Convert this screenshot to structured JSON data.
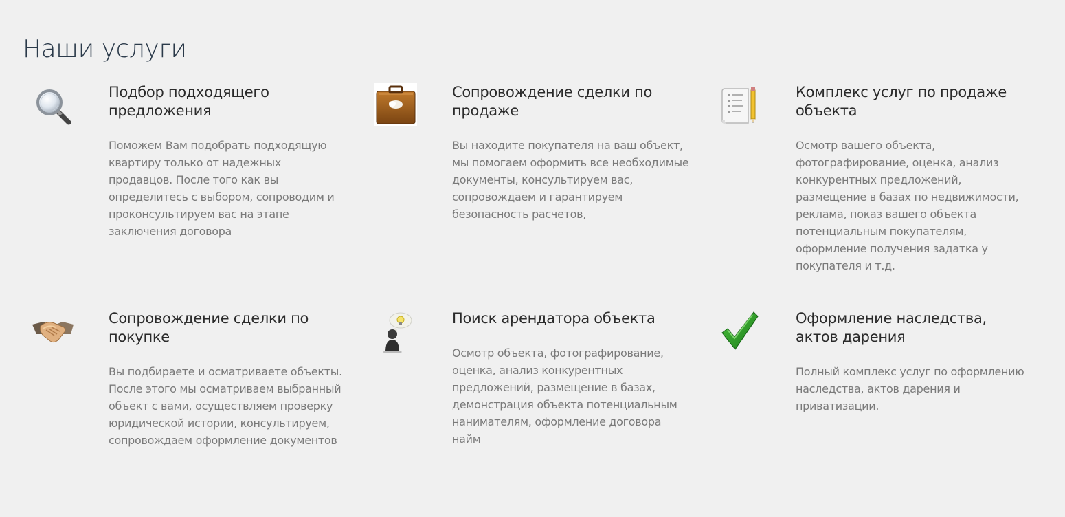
{
  "section": {
    "title": "Наши услуги"
  },
  "services": [
    {
      "icon": "magnifier-icon",
      "title": "Подбор подходящего предложения",
      "description": "Поможем Вам подобрать подходящую квартиру только от надежных продавцов. После того как вы определитесь с выбором, сопроводим и проконсультируем вас на этапе заключения договора"
    },
    {
      "icon": "briefcase-icon",
      "title": "Сопровождение сделки по продаже",
      "description": "Вы находите покупателя на ваш объект, мы помогаем оформить все необходимые документы, консультируем вас, сопровождаем и гарантируем безопасность расчетов,"
    },
    {
      "icon": "document-pencil-icon",
      "title": "Комплекс услуг по продаже объекта",
      "description": "Осмотр вашего объекта, фотографирование, оценка, анализ конкурентных предложений, размещение в базах по недвижимости, реклама, показ вашего объекта потенциальным покупателям, оформление получения задатка у покупателя и т.д."
    },
    {
      "icon": "handshake-icon",
      "title": "Сопровождение сделки по покупке",
      "description": "Вы подбираете и осматриваете объекты. После этого мы осматриваем выбранный объект с вами, осуществляем проверку юридической истории, консультируем, сопровождаем оформление документов"
    },
    {
      "icon": "person-idea-icon",
      "title": "Поиск арендатора объекта",
      "description": "Осмотр объекта, фотографирование, оценка, анализ конкурентных предложений, размещение в базах, демонстрация объекта потенциальным нанимателям, оформление договора найм"
    },
    {
      "icon": "checkmark-icon",
      "title": "Оформление наследства, актов дарения",
      "description": "Полный комплекс услуг по оформлению наследства, актов дарения и приватизации."
    }
  ]
}
